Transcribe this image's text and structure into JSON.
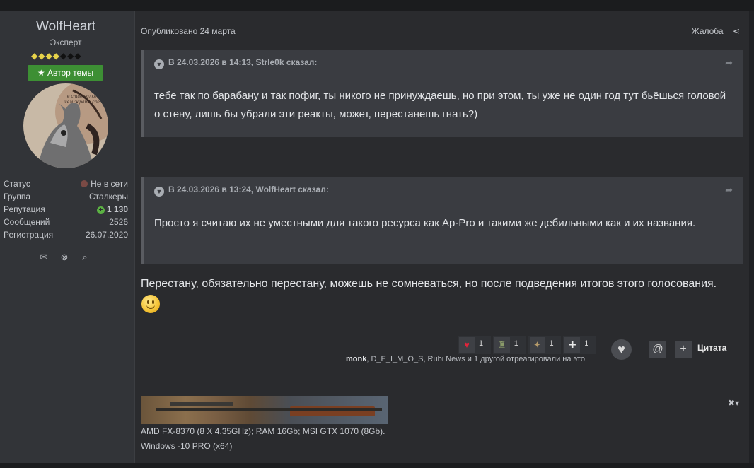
{
  "author": {
    "name": "WolfHeart",
    "title": "Эксперт",
    "rank_pips_on": 4,
    "rank_pips_total": 7,
    "op_badge": "Автор темы",
    "stats": [
      {
        "label": "Статус",
        "value": "Не в сети"
      },
      {
        "label": "Группа",
        "value": "Сталкеры"
      },
      {
        "label": "Репутация",
        "value": "1 130"
      },
      {
        "label": "Сообщений",
        "value": "2526"
      },
      {
        "label": "Регистрация",
        "value": "26.07.2020"
      }
    ],
    "icons": [
      "envelope-icon",
      "block-icon",
      "search-icon"
    ]
  },
  "post": {
    "published": "Опубликовано 24 марта",
    "report": "Жалоба",
    "quotes": [
      {
        "header": "В 24.03.2026 в 14:13, Strle0k сказал:",
        "text": "тебе так по барабану и так пофиг, ты никого не принуждаешь, но при этом, ты уже не один год тут бьёшься головой о стену, лишь бы убрали эти реакты, может, перестанешь гнать?)"
      },
      {
        "header": "В 24.03.2026 в 13:24, WolfHeart сказал:",
        "text": "Просто я считаю их не уместными для такого ресурса как Ap-Pro и такими же дебильными как и их названия."
      }
    ],
    "reply": "Перестану, обязательно перестану, можешь не сомневаться, но после подведения итогов этого голосования.",
    "reactions": [
      {
        "icon": "heart-icon",
        "count": "1"
      },
      {
        "icon": "soldier-icon",
        "count": "1"
      },
      {
        "icon": "handshake-icon",
        "count": "1"
      },
      {
        "icon": "bandage-icon",
        "count": "1"
      }
    ],
    "reacted_users": "monk",
    "reacted_rest": ", D_E_I_M_O_S, Rubi News и 1 другой отреагировали на это",
    "quote_label": "Цитата",
    "signature": {
      "line1": "AMD FX-8370 (8 X 4.35GHz); RAM 16Gb; MSI GTX 1070 (8Gb).",
      "line2": "Windows -10 PRO (x64)"
    }
  }
}
